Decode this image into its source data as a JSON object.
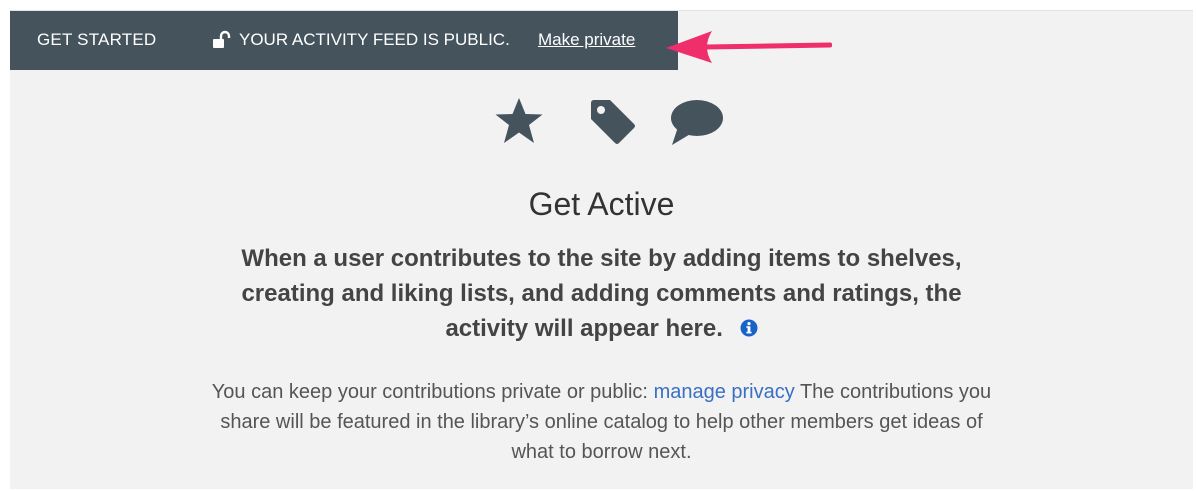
{
  "topbar": {
    "get_started": "GET STARTED",
    "feed_status": "YOUR ACTIVITY FEED IS PUBLIC.",
    "make_private": "Make private",
    "background_color": "#44535c"
  },
  "annotation": {
    "arrow_color": "#ef2f6b"
  },
  "activity_icons": [
    "star-icon",
    "tag-icon",
    "comment-icon"
  ],
  "main": {
    "heading": "Get Active",
    "lead_text": "When a user contributes to the site by adding items to shelves, creating and liking lists, and adding comments and ratings, the activity will appear here.",
    "privacy_text_before": "You can keep your contributions private or public:",
    "manage_privacy_link": "manage privacy",
    "privacy_text_after": "The contributions you share will be featured in the library’s online catalog to help other members get ideas of what to borrow next.",
    "link_color": "#3b6fc2",
    "info_icon_color": "#1a63c6"
  }
}
